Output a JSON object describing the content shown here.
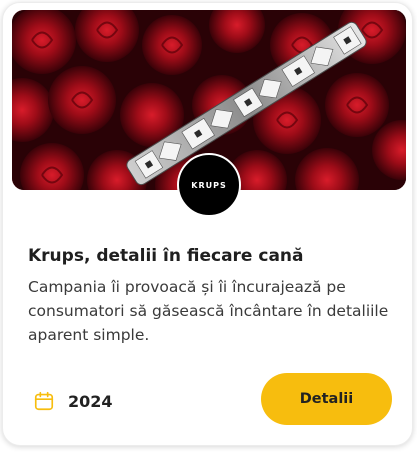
{
  "card": {
    "brand_logo_text": "KRUPS",
    "title": "Krups, detalii în fiecare cană",
    "description": "Campania îi provoacă și îi încurajează pe consumatori să găsească încântare în detaliile aparent simple.",
    "year": "2024",
    "details_button_label": "Detalii",
    "calendar_icon": "calendar-icon",
    "accent_color": "#f7bd0e"
  }
}
